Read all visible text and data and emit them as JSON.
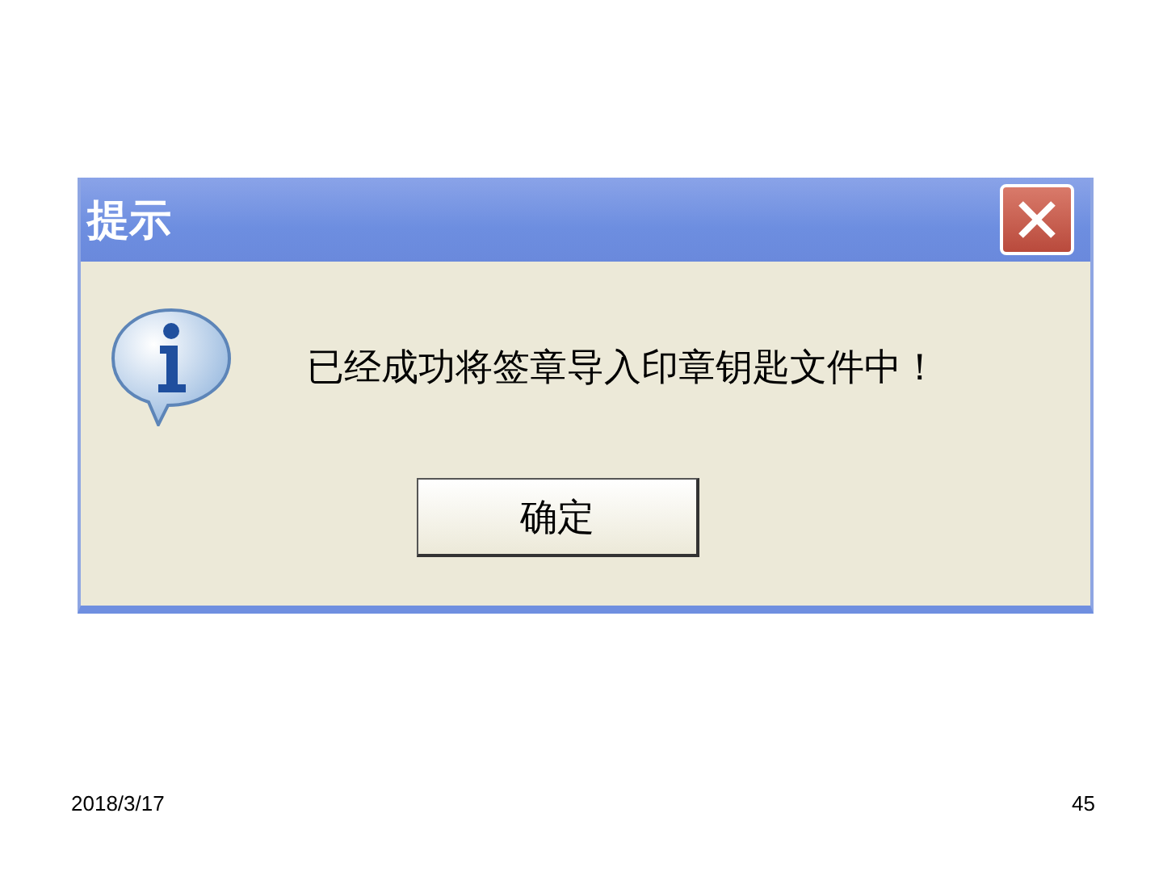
{
  "dialog": {
    "title": "提示",
    "message": "已经成功将签章导入印章钥匙文件中！",
    "buttons": [
      "确定"
    ]
  },
  "footer": {
    "date": "2018/3/17",
    "page": "45"
  }
}
